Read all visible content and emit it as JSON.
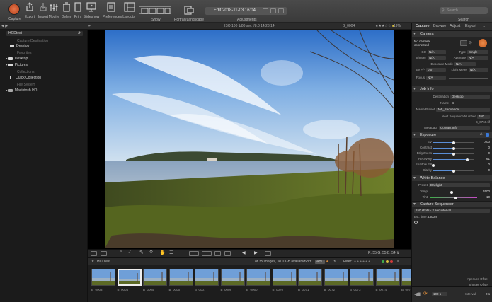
{
  "toolbar": {
    "buttons": [
      {
        "label": "Capture",
        "icon": "record-icon"
      },
      {
        "label": "Export",
        "icon": "export-icon"
      },
      {
        "label": "Import",
        "icon": "import-icon"
      },
      {
        "label": "Modify",
        "icon": "modify-icon"
      },
      {
        "label": "Delete",
        "icon": "trash-icon"
      },
      {
        "label": "Print",
        "icon": "print-icon"
      },
      {
        "label": "Slideshow",
        "icon": "slideshow-icon"
      },
      {
        "label": "Preferences",
        "icon": "preferences-icon"
      },
      {
        "label": "Layouts",
        "icon": "layouts-icon"
      }
    ],
    "show_label": "Show",
    "portrait_label": "Portrait/Landscape",
    "adjustments_label": "Adjustments",
    "title": "Edit 2018-11-03 16:04",
    "search_placeholder": "Search",
    "search_label": "Search"
  },
  "subbar": {
    "library": "HCDtest",
    "exif": "ISO 100   1/80 sec   f/8.0   14/23 14",
    "filename": "B_0004",
    "zoom": "19%"
  },
  "left_panel": {
    "sections": [
      {
        "title": "Capture Destination",
        "items": [
          "Desktop"
        ]
      },
      {
        "title": "Favorites",
        "items": [
          "Desktop",
          "Pictures"
        ]
      },
      {
        "title": "Collections",
        "items": [
          "Quick Collection"
        ]
      },
      {
        "title": "File System",
        "items": [
          "Macintosh HD"
        ]
      }
    ]
  },
  "viewer_tools": {
    "readout": "R: 55  G: 55  B: 54  ⇅"
  },
  "browser": {
    "tab": "HCDtest",
    "count": "1 of 35 images, 50.0 GB available",
    "sort_label": "Sort:",
    "sort_value": "ABC",
    "filter_label": "Filter:"
  },
  "filmstrip": {
    "thumbs": [
      "B_0003",
      "B_0004",
      "B_0005",
      "B_0006",
      "B_0007",
      "B_0008",
      "B_0060",
      "B_0070",
      "B_0071",
      "B_0072",
      "B_0073",
      "B_0074",
      "B_0075"
    ],
    "selected_index": 1
  },
  "right_panel": {
    "tabs": [
      "Capture",
      "Browse",
      "Adjust",
      "Export",
      "…"
    ],
    "active_tab": 0,
    "camera": {
      "title": "Camera",
      "status": "No camera connected",
      "iso_label": "ISO",
      "iso": "N/A",
      "type_label": "Type",
      "type": "Single",
      "shutter_label": "Shutter",
      "shutter": "N/A",
      "aperture_label": "Aperture",
      "aperture": "N/A",
      "mode_label": "Exposure Mode",
      "mode": "N/A",
      "ev_label": "EV +/-",
      "ev": "0,0",
      "meter_label": "Light Meter",
      "meter": "N/A",
      "focus_label": "Focus",
      "focus": "N/A"
    },
    "job_info": {
      "title": "Job Info",
      "destination_label": "Destination",
      "destination": "Desktop",
      "name_label": "Name",
      "name": "B",
      "preset_label": "Name Preset",
      "preset": "Job_Sequence",
      "next_label": "Next Sequence Number",
      "next": "760",
      "next_file": "B_0760.tif",
      "metadata_label": "Metadata",
      "metadata": "Contact Info"
    },
    "exposure": {
      "title": "Exposure",
      "sliders": [
        {
          "label": "EV",
          "value": "0,00",
          "pos": 0.5
        },
        {
          "label": "Contrast",
          "value": "0",
          "pos": 0.5
        },
        {
          "label": "Brightness",
          "value": "0",
          "pos": 0.5
        },
        {
          "label": "Recovery",
          "value": "61",
          "pos": 0.82
        },
        {
          "label": "Shadow Fill",
          "value": "0",
          "pos": 0.0
        },
        {
          "label": "Clarity",
          "value": "0",
          "pos": 0.5
        }
      ]
    },
    "white_balance": {
      "title": "White Balance",
      "preset_label": "Preset",
      "preset": "Daylight",
      "temp_label": "Temp",
      "temp": "5500",
      "temp_pos": 0.45,
      "tint_label": "Tint",
      "tint": "10",
      "tint_pos": 0.55
    },
    "sequencer": {
      "title": "Capture Sequencer",
      "preset": "150 shots - 2 sec interval",
      "duration_label": "Est. time:",
      "duration": "4300 s"
    },
    "bottom": {
      "aperture_label": "Aperture Offset",
      "shutter_label": "Shutter Offset",
      "shots": "100 s",
      "interval_label": "Interval",
      "interval": "2 s"
    }
  }
}
